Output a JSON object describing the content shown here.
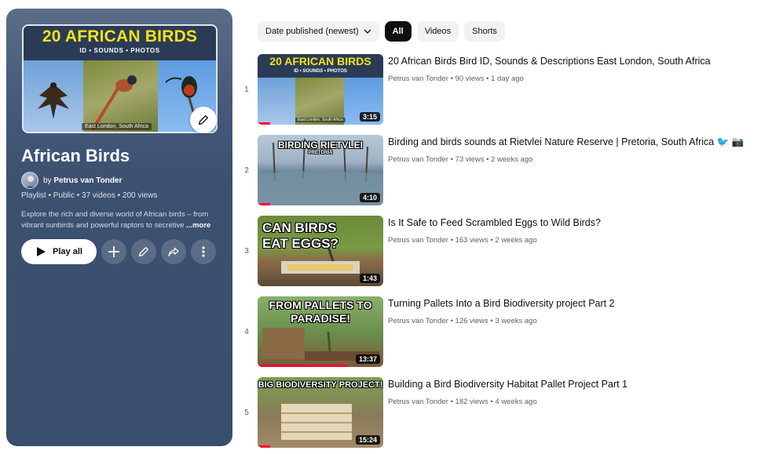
{
  "playlist": {
    "thumbnail": {
      "title": "20 AFRICAN BIRDS",
      "subtitle": "ID • SOUNDS • PHOTOS",
      "caption": "East London, South Africa"
    },
    "title": "African Birds",
    "owner_prefix": "by ",
    "owner": "Petrus van Tonder",
    "meta": "Playlist • Public • 37 videos • 200 views",
    "description": "Explore the rich and diverse world of African birds – from vibrant sunbirds and powerful raptors to secretive",
    "more_label": "...more",
    "play_all_label": "Play all",
    "icons": [
      "play-icon",
      "add-icon",
      "pencil-icon",
      "share-icon",
      "more-vert-icon"
    ]
  },
  "filters": {
    "sort_label": "Date published (newest)",
    "chips": [
      "All",
      "Videos",
      "Shorts"
    ],
    "active_chip": "All"
  },
  "videos": [
    {
      "index": "1",
      "title": "20 African Birds Bird ID, Sounds & Descriptions East London, South Africa",
      "channel": "Petrus van Tonder",
      "stats": "90 views • 1 day ago",
      "duration": "3:15",
      "thumb_text": "20 AFRICAN BIRDS",
      "thumb_sub": "ID • SOUNDS • PHOTOS",
      "thumb_caption": "East London, South Africa",
      "watched_fraction": 0.1
    },
    {
      "index": "2",
      "title": "Birding and birds sounds at Rietvlei Nature Reserve | Pretoria, South Africa 🐦 📷",
      "channel": "Petrus van Tonder",
      "stats": "73 views • 2 weeks ago",
      "duration": "4:10",
      "thumb_text": "BIRDING RIETVLEI",
      "thumb_sub": "PRETORIA",
      "watched_fraction": 0.1
    },
    {
      "index": "3",
      "title": "Is It Safe to Feed Scrambled Eggs to Wild Birds?",
      "channel": "Petrus van Tonder",
      "stats": "163 views • 2 weeks ago",
      "duration": "1:43",
      "thumb_text": "CAN BIRDS EAT EGGS?",
      "watched_fraction": 0
    },
    {
      "index": "4",
      "title": "Turning Pallets Into a Bird Biodiversity project Part 2",
      "channel": "Petrus van Tonder",
      "stats": "126 views • 3 weeks ago",
      "duration": "13:37",
      "thumb_text": "FROM PALLETS TO PARADISE!",
      "watched_fraction": 0.72
    },
    {
      "index": "5",
      "title": "Building a Bird Biodiversity Habitat Pallet Project Part 1",
      "channel": "Petrus van Tonder",
      "stats": "182 views • 4 weeks ago",
      "duration": "15:24",
      "thumb_text": "BIG BIODIVERSITY PROJECT!",
      "watched_fraction": 0.1
    }
  ],
  "colors": {
    "panel": "#3c5070",
    "progress": "#ff0033",
    "thumb_title_yellow": "#f4e21c"
  }
}
